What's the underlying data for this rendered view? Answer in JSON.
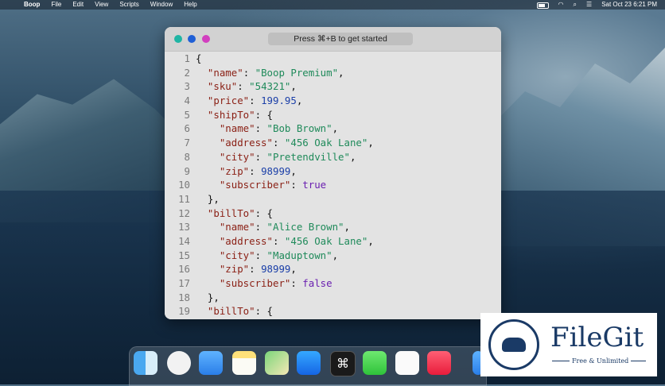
{
  "menubar": {
    "app_name": "Boop",
    "menus": [
      "File",
      "Edit",
      "View",
      "Scripts",
      "Window",
      "Help"
    ],
    "clock": "Sat Oct 23  6:21 PM"
  },
  "window": {
    "search_placeholder": "Press ⌘+B to get started",
    "lines": [
      {
        "n": "1",
        "parts": [
          [
            "p",
            "{"
          ]
        ]
      },
      {
        "n": "2",
        "parts": [
          [
            "p",
            "  "
          ],
          [
            "k",
            "\"name\""
          ],
          [
            "p",
            ": "
          ],
          [
            "s",
            "\"Boop Premium\""
          ],
          [
            "p",
            ","
          ]
        ]
      },
      {
        "n": "3",
        "parts": [
          [
            "p",
            "  "
          ],
          [
            "k",
            "\"sku\""
          ],
          [
            "p",
            ": "
          ],
          [
            "s",
            "\"54321\""
          ],
          [
            "p",
            ","
          ]
        ]
      },
      {
        "n": "4",
        "parts": [
          [
            "p",
            "  "
          ],
          [
            "k",
            "\"price\""
          ],
          [
            "p",
            ": "
          ],
          [
            "n",
            "199.95"
          ],
          [
            "p",
            ","
          ]
        ]
      },
      {
        "n": "5",
        "parts": [
          [
            "p",
            "  "
          ],
          [
            "k",
            "\"shipTo\""
          ],
          [
            "p",
            ": {"
          ]
        ]
      },
      {
        "n": "6",
        "parts": [
          [
            "p",
            "    "
          ],
          [
            "k",
            "\"name\""
          ],
          [
            "p",
            ": "
          ],
          [
            "s",
            "\"Bob Brown\""
          ],
          [
            "p",
            ","
          ]
        ]
      },
      {
        "n": "7",
        "parts": [
          [
            "p",
            "    "
          ],
          [
            "k",
            "\"address\""
          ],
          [
            "p",
            ": "
          ],
          [
            "s",
            "\"456 Oak Lane\""
          ],
          [
            "p",
            ","
          ]
        ]
      },
      {
        "n": "8",
        "parts": [
          [
            "p",
            "    "
          ],
          [
            "k",
            "\"city\""
          ],
          [
            "p",
            ": "
          ],
          [
            "s",
            "\"Pretendville\""
          ],
          [
            "p",
            ","
          ]
        ]
      },
      {
        "n": "9",
        "parts": [
          [
            "p",
            "    "
          ],
          [
            "k",
            "\"zip\""
          ],
          [
            "p",
            ": "
          ],
          [
            "n",
            "98999"
          ],
          [
            "p",
            ","
          ]
        ]
      },
      {
        "n": "10",
        "parts": [
          [
            "p",
            "    "
          ],
          [
            "k",
            "\"subscriber\""
          ],
          [
            "p",
            ": "
          ],
          [
            "b",
            "true"
          ]
        ]
      },
      {
        "n": "11",
        "parts": [
          [
            "p",
            "  },"
          ]
        ]
      },
      {
        "n": "12",
        "parts": [
          [
            "p",
            "  "
          ],
          [
            "k",
            "\"billTo\""
          ],
          [
            "p",
            ": {"
          ]
        ]
      },
      {
        "n": "13",
        "parts": [
          [
            "p",
            "    "
          ],
          [
            "k",
            "\"name\""
          ],
          [
            "p",
            ": "
          ],
          [
            "s",
            "\"Alice Brown\""
          ],
          [
            "p",
            ","
          ]
        ]
      },
      {
        "n": "14",
        "parts": [
          [
            "p",
            "    "
          ],
          [
            "k",
            "\"address\""
          ],
          [
            "p",
            ": "
          ],
          [
            "s",
            "\"456 Oak Lane\""
          ],
          [
            "p",
            ","
          ]
        ]
      },
      {
        "n": "15",
        "parts": [
          [
            "p",
            "    "
          ],
          [
            "k",
            "\"city\""
          ],
          [
            "p",
            ": "
          ],
          [
            "s",
            "\"Maduptown\""
          ],
          [
            "p",
            ","
          ]
        ]
      },
      {
        "n": "16",
        "parts": [
          [
            "p",
            "    "
          ],
          [
            "k",
            "\"zip\""
          ],
          [
            "p",
            ": "
          ],
          [
            "n",
            "98999"
          ],
          [
            "p",
            ","
          ]
        ]
      },
      {
        "n": "17",
        "parts": [
          [
            "p",
            "    "
          ],
          [
            "k",
            "\"subscriber\""
          ],
          [
            "p",
            ": "
          ],
          [
            "b",
            "false"
          ]
        ]
      },
      {
        "n": "18",
        "parts": [
          [
            "p",
            "  },"
          ]
        ]
      },
      {
        "n": "19",
        "parts": [
          [
            "p",
            "  "
          ],
          [
            "k",
            "\"billTo\""
          ],
          [
            "p",
            ": {"
          ]
        ]
      }
    ]
  },
  "dock": {
    "items": [
      "finder-icon",
      "safari-icon",
      "mail-icon",
      "notes-icon",
      "maps-icon",
      "app-store-icon",
      "boop-icon",
      "messages-icon",
      "photos-icon",
      "music-icon",
      "folder-icon"
    ],
    "boop_glyph": "⌘"
  },
  "watermark": {
    "title": "FileGit",
    "subtitle": "Free & Unlimited"
  },
  "colors": {
    "key": "#8a1f14",
    "string": "#1f8a5a",
    "number": "#1b3fa8",
    "boolean": "#6a1fb0"
  }
}
